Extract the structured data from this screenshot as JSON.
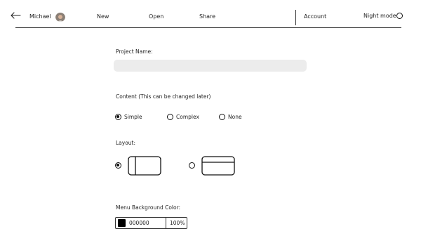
{
  "header": {
    "user_name": "Michael",
    "nav": {
      "new": "New",
      "open": "Open",
      "share": "Share",
      "account": "Account"
    },
    "night_mode_label": "Night mode",
    "night_mode_on": false
  },
  "form": {
    "project_name_label": "Project Name:",
    "project_name_value": "",
    "content_label": "Content (This can be changed later)",
    "content_options": [
      "Simple",
      "Complex",
      "None"
    ],
    "content_selected": "Simple",
    "layout_label": "Layout:",
    "layout_selected_index": 0,
    "menu_bg_label": "Menu Background Color:",
    "menu_bg_hex": "000000",
    "menu_bg_opacity": "100%",
    "menu_bg_color": "#000000"
  },
  "icons": {
    "back": "arrow-left-icon",
    "avatar": "user-avatar",
    "night_mode": "radio-circle-icon"
  }
}
